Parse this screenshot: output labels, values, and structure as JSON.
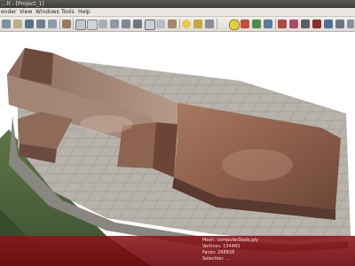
{
  "window": {
    "title": "...lt - [Project_1]"
  },
  "menu": {
    "items": [
      {
        "label": "ender"
      },
      {
        "label": "View"
      },
      {
        "label": "Windows"
      },
      {
        "label": "Tools"
      },
      {
        "label": "Help"
      }
    ]
  },
  "toolbar": {
    "icons": [
      "new-project-icon",
      "open-project-icon",
      "save-project-icon",
      "import-mesh-icon",
      "export-mesh-icon",
      "snapshot-icon",
      "layers-icon",
      "bounding-box-icon",
      "points-view-icon",
      "wireframe-view-icon",
      "hidden-lines-icon",
      "flat-lines-icon",
      "flat-shading-icon",
      "smooth-shading-icon",
      "texture-icon",
      "light-icon",
      "lighting-icon",
      "back-face-icon",
      "transform-icon",
      "annotation-icon",
      "measure-icon",
      "pick-points-icon",
      "align-icon",
      "selection-icon",
      "select-vertices-icon",
      "select-connected-icon",
      "delete-icon",
      "paint-icon",
      "zoom-icon",
      "rotate-icon",
      "settings-icon"
    ]
  },
  "info": {
    "mesh": "Mesh: computer3avis.ply",
    "vertices": "Vertices: 134483",
    "faces": "Faces: 268826",
    "selection": "Selection: ..."
  },
  "colors": {
    "info_background": "#8c1419",
    "title_background": "#4a4844",
    "stone": "#8a5f4c",
    "grass": "#4f6a3e"
  }
}
